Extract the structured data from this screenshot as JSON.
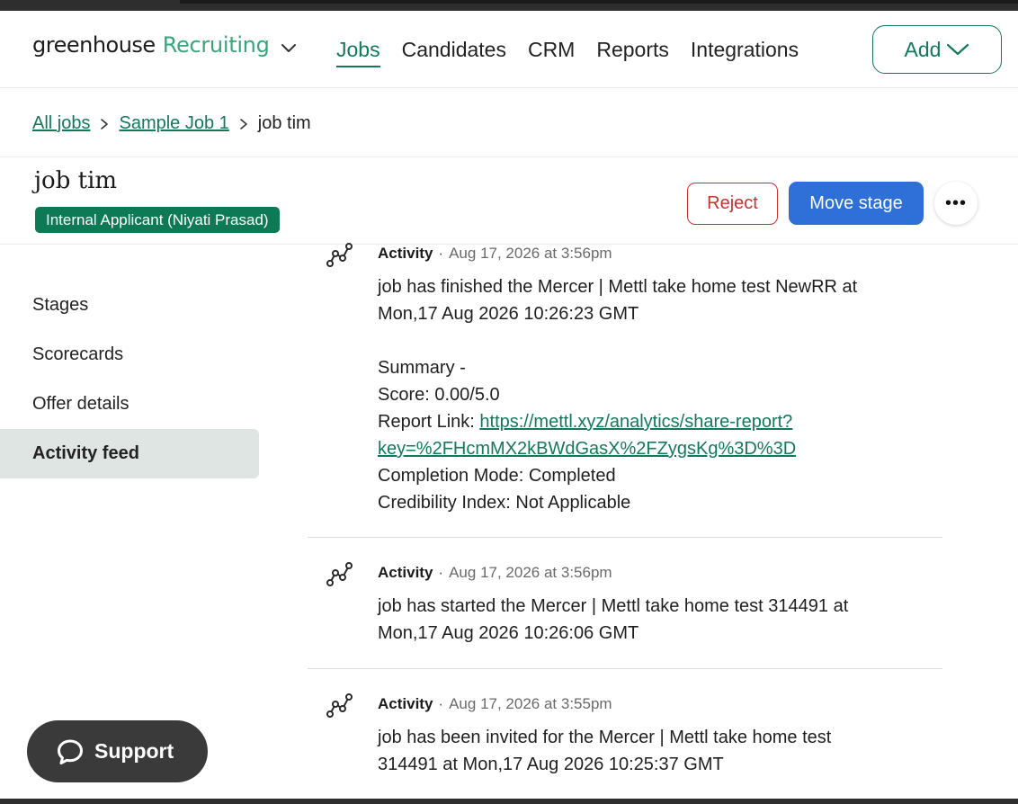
{
  "header": {
    "logo_text": "greenhouse",
    "product_name": "Recruiting",
    "nav": [
      {
        "label": "Jobs",
        "active": true
      },
      {
        "label": "Candidates"
      },
      {
        "label": "CRM"
      },
      {
        "label": "Reports"
      },
      {
        "label": "Integrations"
      }
    ],
    "add_label": "Add"
  },
  "breadcrumb": {
    "items": [
      {
        "label": "All jobs"
      },
      {
        "label": "Sample Job 1"
      },
      {
        "label": "job tim"
      }
    ]
  },
  "candidate": {
    "name": "job tim",
    "badge": "Internal Applicant (Niyati Prasad)"
  },
  "actions": {
    "reject": "Reject",
    "move_stage": "Move stage",
    "more": "•••"
  },
  "sidebar": {
    "items": [
      {
        "label": "Stages"
      },
      {
        "label": "Scorecards"
      },
      {
        "label": "Offer details"
      },
      {
        "label": "Activity feed",
        "active": true
      }
    ]
  },
  "feed": [
    {
      "type": "Activity",
      "timestamp": "Aug 17, 2026 at 3:56pm",
      "line1": "job has finished the Mercer | Mettl take home test NewRR at",
      "line2": "Mon,17 Aug 2026 10:26:23 GMT",
      "summary": "Summary -",
      "score": "Score: 0.00/5.0",
      "report_label": "Report Link: ",
      "report_link_1": "https://mettl.xyz/analytics/share-report?",
      "report_link_2": "key=%2FHcmMX2kBWdGasX%2FZygsKg%3D%3D",
      "completion": "Completion Mode: Completed",
      "credibility": "Credibility Index: Not Applicable"
    },
    {
      "type": "Activity",
      "timestamp": "Aug 17, 2026 at 3:56pm",
      "line1": "job has started the Mercer | Mettl take home test 314491 at",
      "line2": "Mon,17 Aug 2026 10:26:06 GMT"
    },
    {
      "type": "Activity",
      "timestamp": "Aug 17, 2026 at 3:55pm",
      "line1": "job has been invited for the Mercer | Mettl take home test",
      "line2": "314491 at Mon,17 Aug 2026 10:25:37 GMT"
    }
  ],
  "support": {
    "label": "Support"
  },
  "colors": {
    "brand_green": "#127a58",
    "badge_green": "#0e7a55",
    "primary_blue": "#2e6fd8",
    "reject_red": "#c8332c"
  }
}
